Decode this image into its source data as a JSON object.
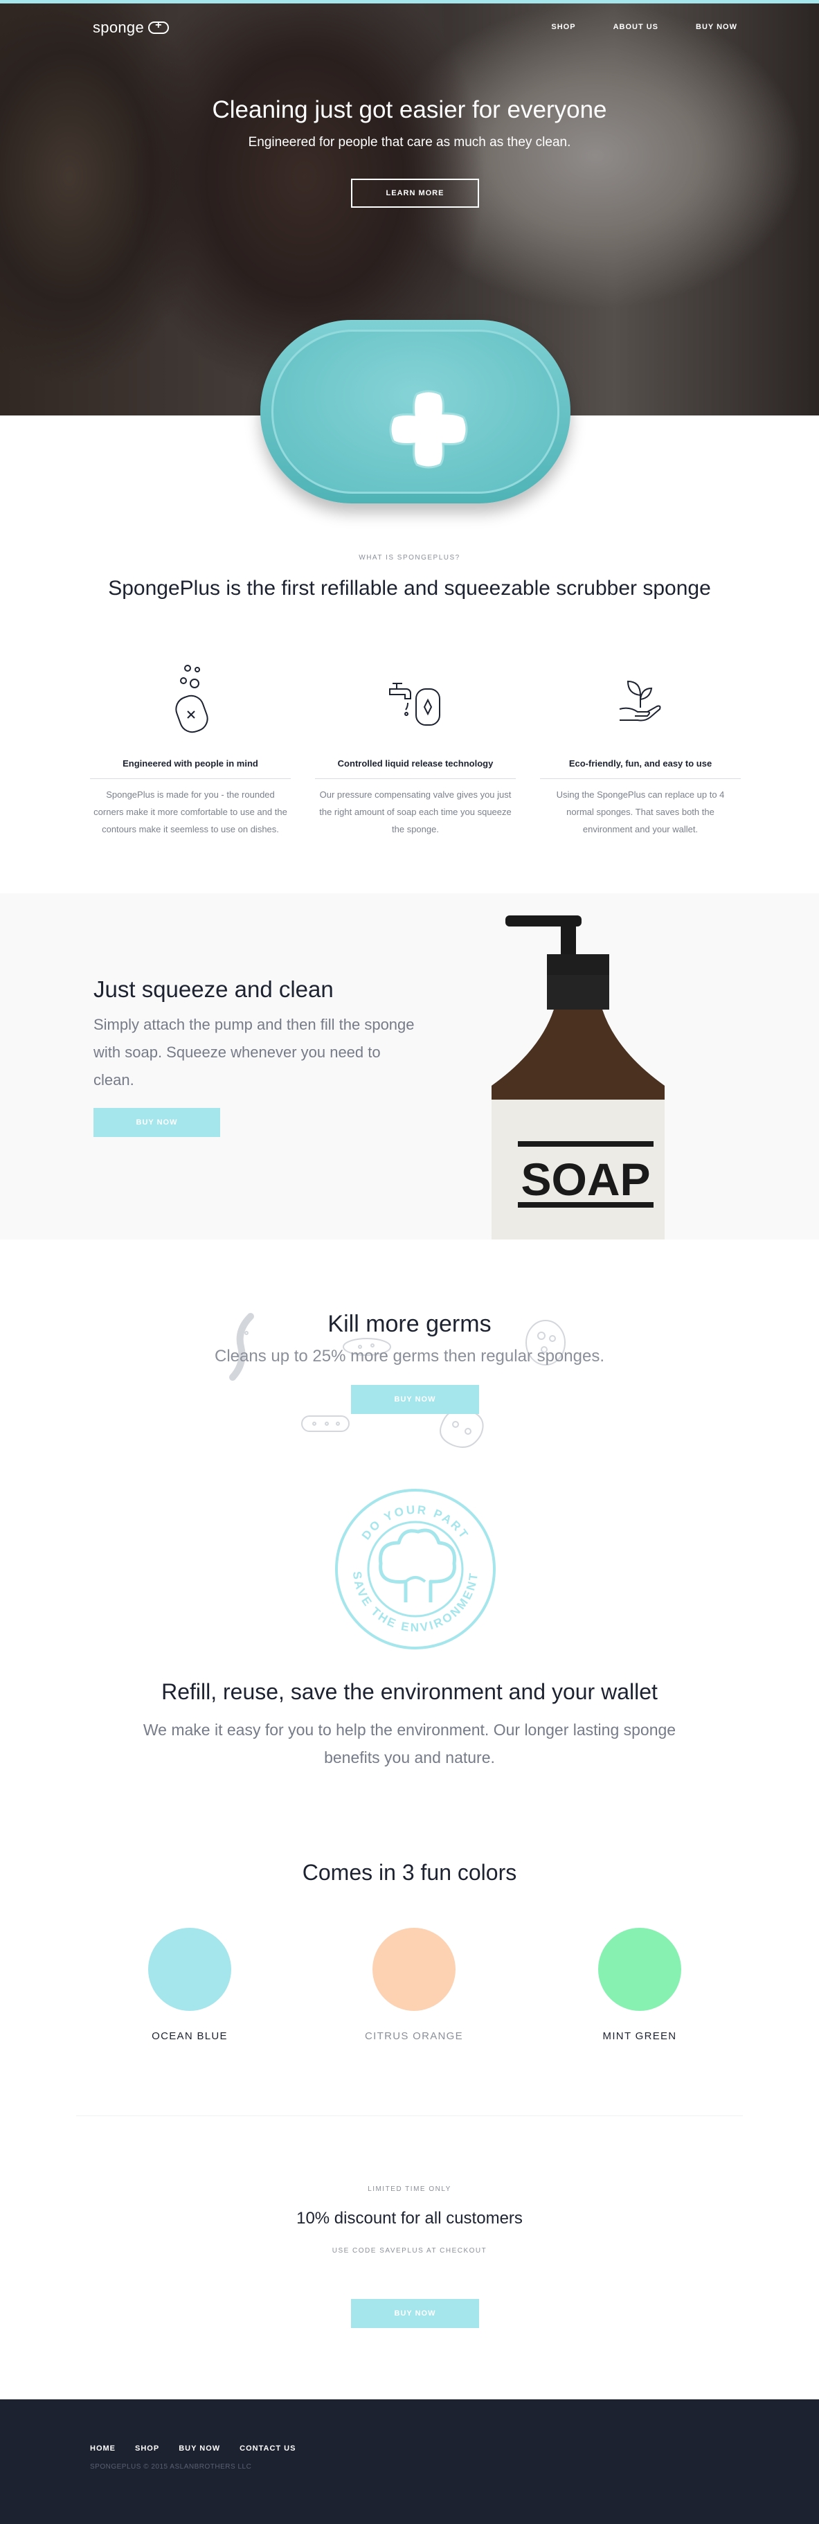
{
  "nav": {
    "logo_text": "sponge",
    "links": [
      "SHOP",
      "ABOUT US",
      "BUY NOW"
    ]
  },
  "hero": {
    "title": "Cleaning just got easier for everyone",
    "subtitle": "Engineered for people that care as much as they clean.",
    "cta_label": "LEARN MORE"
  },
  "intro": {
    "eyebrow": "WHAT IS SPONGEPLUS?",
    "headline": "SpongePlus is the first refillable and squeezable scrubber sponge"
  },
  "features": [
    {
      "icon": "soap-bubbles-icon",
      "title": "Engineered with people in mind",
      "text": "SpongePlus is made for you - the rounded corners make it more comfortable to use and the contours make it seemless to use on dishes."
    },
    {
      "icon": "faucet-sponge-icon",
      "title": "Controlled liquid release technology",
      "text": "Our pressure compensating valve gives you just the right amount of soap each time you squeeze the sponge."
    },
    {
      "icon": "plant-hand-icon",
      "title": "Eco-friendly, fun, and easy to use",
      "text": "Using the SpongePlus can replace up to 4 normal sponges. That saves both the environment and your wallet."
    }
  ],
  "squeeze": {
    "title": "Just squeeze and clean",
    "text": "Simply attach the pump and then fill the sponge with soap. Squeeze whenever you need to clean.",
    "cta_label": "BUY NOW",
    "bottle_label": "SOAP"
  },
  "germs": {
    "title": "Kill more germs",
    "text": "Cleans up to 25% more germs then regular sponges.",
    "cta_label": "BUY NOW"
  },
  "badge": {
    "top_text": "DO YOUR PART",
    "bottom_text": "SAVE THE ENVIRONMENT"
  },
  "environment": {
    "title": "Refill, reuse, save the environment and your wallet",
    "text": "We make it easy for you to help the environment. Our longer lasting sponge benefits you and nature."
  },
  "colors": {
    "title": "Comes in 3 fun colors",
    "items": [
      {
        "label": "OCEAN BLUE",
        "color": "#a4e6ec",
        "label_color": "#1d2230"
      },
      {
        "label": "CITRUS ORANGE",
        "color": "#fdd2b2",
        "label_color": "#8a8f99"
      },
      {
        "label": "MINT GREEN",
        "color": "#87f1b2",
        "label_color": "#1d2230"
      }
    ]
  },
  "promo": {
    "eyebrow": "LIMITED TIME ONLY",
    "title": "10% discount for all customers",
    "code_text": "USE CODE SAVEPLUS AT CHECKOUT",
    "cta_label": "BUY NOW"
  },
  "footer": {
    "links": [
      "HOME",
      "SHOP",
      "BUY NOW",
      "CONTACT US"
    ],
    "copyright": "SPONGEPLUS © 2015 ASLANBROTHERS LLC"
  },
  "theme": {
    "accent": "#a4e6ec",
    "dark": "#1d2230",
    "sponge": "#5fbec1"
  }
}
